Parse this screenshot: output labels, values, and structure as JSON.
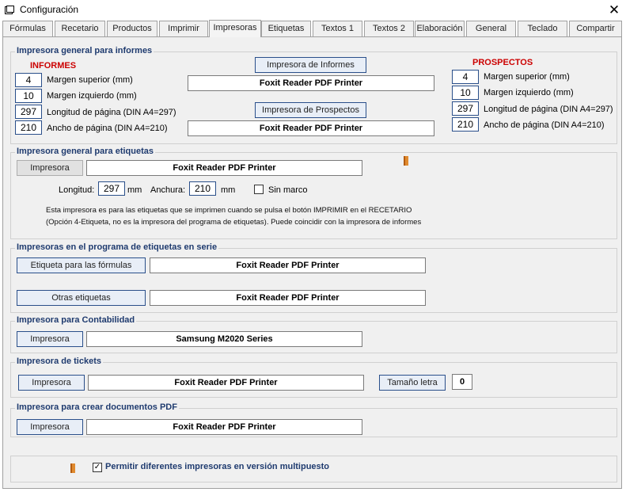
{
  "window": {
    "title": "Configuración",
    "close_glyph": "✕"
  },
  "tabs": [
    {
      "label": "Fórmulas"
    },
    {
      "label": "Recetario"
    },
    {
      "label": "Productos"
    },
    {
      "label": "Imprimir"
    },
    {
      "label": "Impresoras"
    },
    {
      "label": "Etiquetas"
    },
    {
      "label": "Textos 1"
    },
    {
      "label": "Textos 2"
    },
    {
      "label": "Elaboración"
    },
    {
      "label": "General"
    },
    {
      "label": "Teclado"
    },
    {
      "label": "Compartir"
    }
  ],
  "active_tab": "Impresoras",
  "informes_group": {
    "title": "Impresora general para informes",
    "informes_label": "INFORMES",
    "prospectos_label": "PROSPECTOS",
    "informes": {
      "margen_superior": "4",
      "margen_superior_label": "Margen superior (mm)",
      "margen_izquierdo": "10",
      "margen_izquierdo_label": "Margen izquierdo (mm)",
      "longitud": "297",
      "longitud_label": "Longitud de página (DIN A4=297)",
      "ancho": "210",
      "ancho_label": "Ancho de página (DIN A4=210)"
    },
    "prospectos": {
      "margen_superior": "4",
      "margen_superior_label": "Margen superior (mm)",
      "margen_izquierdo": "10",
      "margen_izquierdo_label": "Margen izquierdo (mm)",
      "longitud": "297",
      "longitud_label": "Longitud de página (DIN A4=297)",
      "ancho": "210",
      "ancho_label": "Ancho de página (DIN A4=210)"
    },
    "informes_button": "Impresora de Informes",
    "informes_printer": "Foxit Reader PDF Printer",
    "prospectos_button": "Impresora de Prospectos",
    "prospectos_printer": "Foxit Reader PDF Printer"
  },
  "etiquetas_group": {
    "title": "Impresora general para etiquetas",
    "button": "Impresora",
    "printer": "Foxit Reader PDF Printer",
    "longitud_label": "Longitud:",
    "longitud": "297",
    "longitud_unit": "mm",
    "anchura_label": "Anchura:",
    "anchura": "210",
    "anchura_unit": "mm",
    "sin_marco_label": "Sin marco",
    "sin_marco_checked": false,
    "note_line1": "Esta impresora es para las etiquetas que se imprimen cuando se pulsa el botón IMPRIMIR en el RECETARIO",
    "note_line2": "(Opción 4-Etiqueta, no es la impresora del programa de etiquetas). Puede coincidir con la impresora de informes"
  },
  "serie_group": {
    "title": "Impresoras en el programa de etiquetas en serie",
    "formulas_button": "Etiqueta para las fórmulas",
    "formulas_printer": "Foxit Reader PDF Printer",
    "otras_button": "Otras etiquetas",
    "otras_printer": "Foxit Reader PDF Printer"
  },
  "contabilidad_group": {
    "title": "Impresora para Contabilidad",
    "button": "Impresora",
    "printer": "Samsung M2020 Series"
  },
  "tickets_group": {
    "title": "Impresora de tickets",
    "button": "Impresora",
    "printer": "Foxit Reader PDF Printer",
    "size_button": "Tamaño letra",
    "size_value": "0"
  },
  "pdf_group": {
    "title": "Impresora para crear documentos PDF",
    "button": "Impresora",
    "printer": "Foxit Reader PDF Printer"
  },
  "multipuesto": {
    "label": "Permitir diferentes impresoras en versión multipuesto",
    "checked": true,
    "check_glyph": "✓"
  }
}
